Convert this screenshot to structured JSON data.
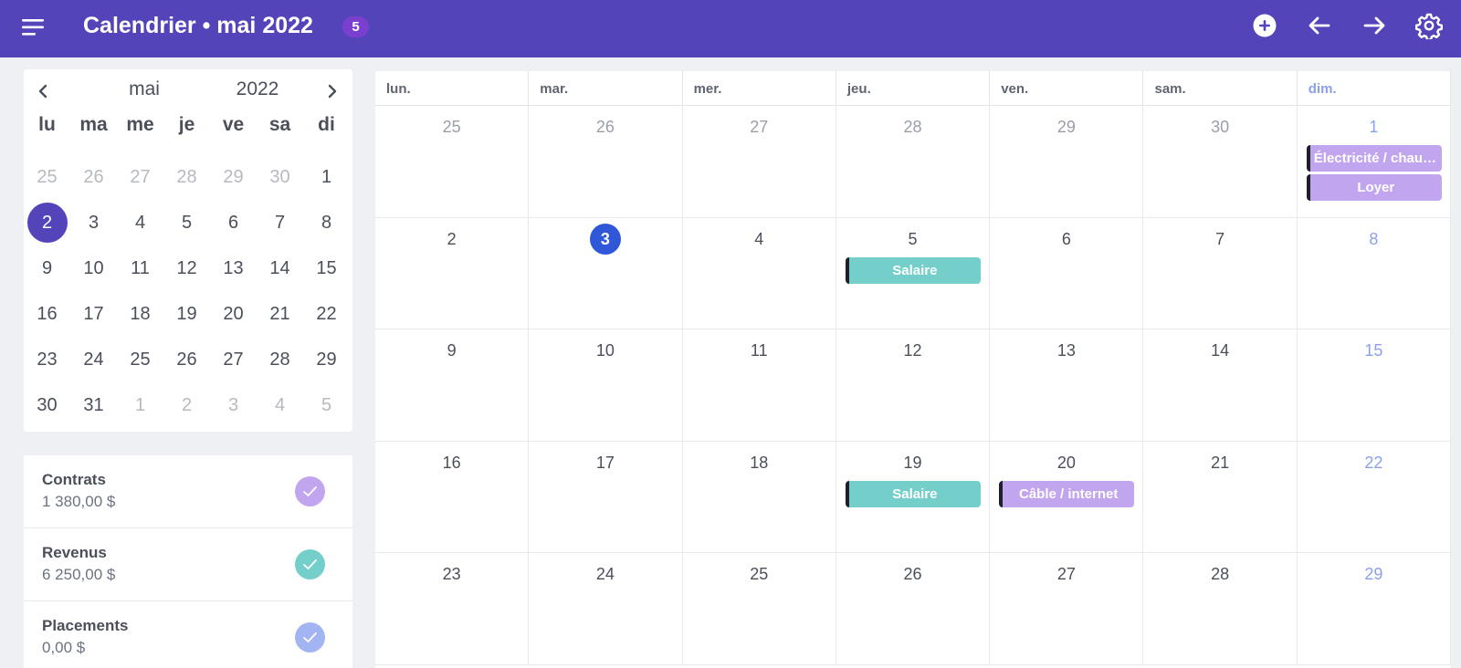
{
  "header": {
    "title": "Calendrier • mai 2022",
    "badge": "5",
    "color": "#5444b9"
  },
  "toolbar": {
    "icons": [
      "add-circle-icon",
      "arrow-left-icon",
      "arrow-right-icon",
      "gear-icon"
    ]
  },
  "minical": {
    "month": "mai",
    "year": "2022",
    "weekdays": [
      "lu",
      "ma",
      "me",
      "je",
      "ve",
      "sa",
      "di"
    ],
    "selected": "2",
    "weeks": [
      [
        {
          "d": "25",
          "m": true
        },
        {
          "d": "26",
          "m": true
        },
        {
          "d": "27",
          "m": true
        },
        {
          "d": "28",
          "m": true
        },
        {
          "d": "29",
          "m": true
        },
        {
          "d": "30",
          "m": true
        },
        {
          "d": "1"
        }
      ],
      [
        {
          "d": "2",
          "s": true
        },
        {
          "d": "3"
        },
        {
          "d": "4"
        },
        {
          "d": "5"
        },
        {
          "d": "6"
        },
        {
          "d": "7"
        },
        {
          "d": "8"
        }
      ],
      [
        {
          "d": "9"
        },
        {
          "d": "10"
        },
        {
          "d": "11"
        },
        {
          "d": "12"
        },
        {
          "d": "13"
        },
        {
          "d": "14"
        },
        {
          "d": "15"
        }
      ],
      [
        {
          "d": "16"
        },
        {
          "d": "17"
        },
        {
          "d": "18"
        },
        {
          "d": "19"
        },
        {
          "d": "20"
        },
        {
          "d": "21"
        },
        {
          "d": "22"
        }
      ],
      [
        {
          "d": "23"
        },
        {
          "d": "24"
        },
        {
          "d": "25"
        },
        {
          "d": "26"
        },
        {
          "d": "27"
        },
        {
          "d": "28"
        },
        {
          "d": "29"
        }
      ],
      [
        {
          "d": "30"
        },
        {
          "d": "31"
        },
        {
          "d": "1",
          "m": true
        },
        {
          "d": "2",
          "m": true
        },
        {
          "d": "3",
          "m": true
        },
        {
          "d": "4",
          "m": true
        },
        {
          "d": "5",
          "m": true
        }
      ]
    ]
  },
  "summary": [
    {
      "name": "Contrats",
      "value": "1 380,00 $",
      "color": "#c1a5ef"
    },
    {
      "name": "Revenus",
      "value": "6 250,00 $",
      "color": "#74cfca"
    },
    {
      "name": "Placements",
      "value": "0,00 $",
      "color": "#a3b4f2"
    }
  ],
  "calendar": {
    "weekdays": [
      "lun.",
      "mar.",
      "mer.",
      "jeu.",
      "ven.",
      "sam.",
      "dim."
    ],
    "weeks": [
      [
        {
          "d": "25",
          "m": true
        },
        {
          "d": "26",
          "m": true
        },
        {
          "d": "27",
          "m": true
        },
        {
          "d": "28",
          "m": true
        },
        {
          "d": "29",
          "m": true
        },
        {
          "d": "30",
          "m": true
        },
        {
          "d": "1",
          "events": [
            {
              "label": "Électricité / chauffage",
              "color": "purple"
            },
            {
              "label": "Loyer",
              "color": "purple"
            }
          ]
        }
      ],
      [
        {
          "d": "2"
        },
        {
          "d": "3",
          "today": true
        },
        {
          "d": "4"
        },
        {
          "d": "5",
          "events": [
            {
              "label": "Salaire",
              "color": "teal"
            }
          ]
        },
        {
          "d": "6"
        },
        {
          "d": "7"
        },
        {
          "d": "8"
        }
      ],
      [
        {
          "d": "9"
        },
        {
          "d": "10"
        },
        {
          "d": "11"
        },
        {
          "d": "12"
        },
        {
          "d": "13"
        },
        {
          "d": "14"
        },
        {
          "d": "15"
        }
      ],
      [
        {
          "d": "16"
        },
        {
          "d": "17"
        },
        {
          "d": "18"
        },
        {
          "d": "19",
          "events": [
            {
              "label": "Salaire",
              "color": "teal"
            }
          ]
        },
        {
          "d": "20",
          "events": [
            {
              "label": "Câble / internet",
              "color": "purple"
            }
          ]
        },
        {
          "d": "21"
        },
        {
          "d": "22"
        }
      ],
      [
        {
          "d": "23"
        },
        {
          "d": "24"
        },
        {
          "d": "25"
        },
        {
          "d": "26"
        },
        {
          "d": "27"
        },
        {
          "d": "28"
        },
        {
          "d": "29"
        }
      ]
    ]
  }
}
